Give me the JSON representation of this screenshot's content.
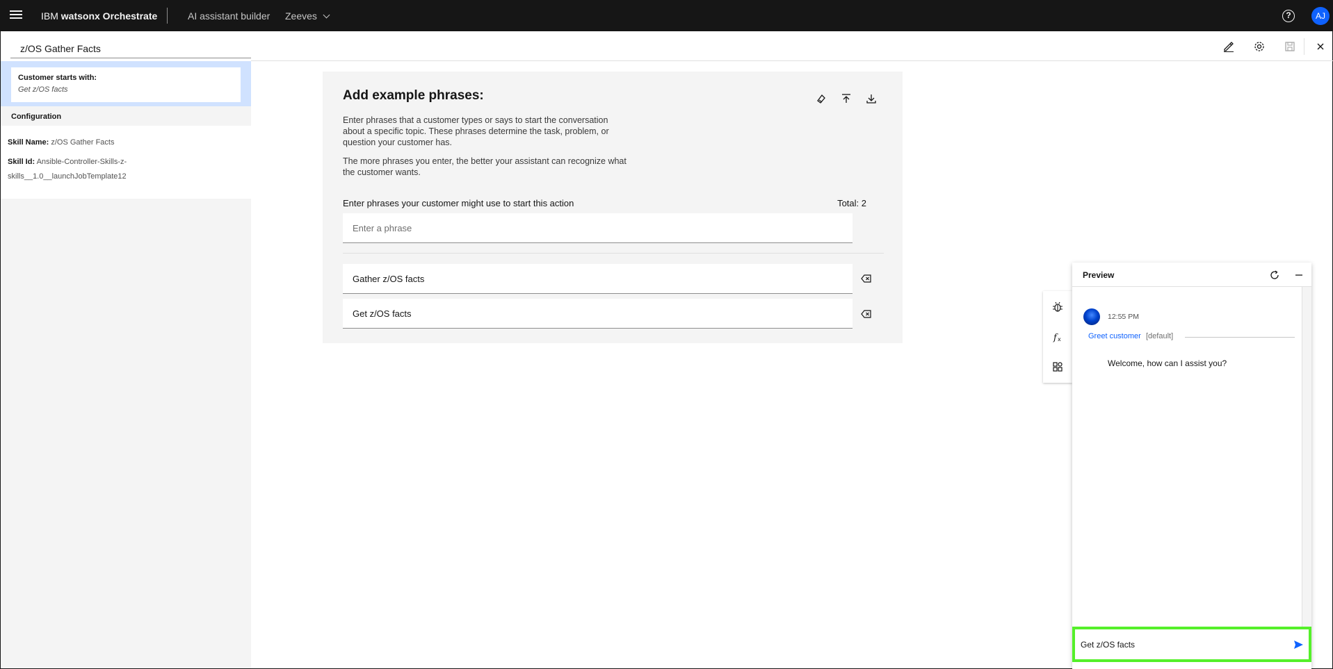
{
  "topbar": {
    "brand_prefix": "IBM ",
    "brand_name": "watsonx Orchestrate",
    "nav_builder": "AI assistant builder",
    "nav_assistant": "Zeeves",
    "avatar_initials": "AJ"
  },
  "action": {
    "title": "z/OS Gather Facts"
  },
  "sidebar": {
    "starts_label": "Customer starts with:",
    "starts_phrase": "Get z/OS facts",
    "config_heading": "Configuration",
    "skill_name_key": "Skill Name:",
    "skill_name_value": "z/OS Gather Facts",
    "skill_id_key": "Skill Id:",
    "skill_id_value_line1": "Ansible-Controller-Skills-z-",
    "skill_id_value_line2": "skills__1.0__launchJobTemplate12"
  },
  "phrases_card": {
    "title": "Add example phrases:",
    "desc1": "Enter phrases that a customer types or says to start the conversation about a specific topic. These phrases determine the task, problem, or question your customer has.",
    "desc2": "The more phrases you enter, the better your assistant can recognize what the customer wants.",
    "input_label": "Enter phrases your customer might use to start this action",
    "total": "Total: 2",
    "input_placeholder": "Enter a phrase",
    "phrases": [
      "Gather z/OS facts",
      "Get z/OS facts"
    ]
  },
  "preview": {
    "title": "Preview",
    "time": "12:55 PM",
    "greet_link": "Greet customer",
    "greet_default": "[default]",
    "welcome": "Welcome, how can I assist you?",
    "chat_input_value": "Get z/OS facts"
  },
  "colors": {
    "accent": "#0f62fe",
    "highlight": "#55f02a",
    "topbar": "#161616",
    "selected": "#d0e2ff"
  }
}
